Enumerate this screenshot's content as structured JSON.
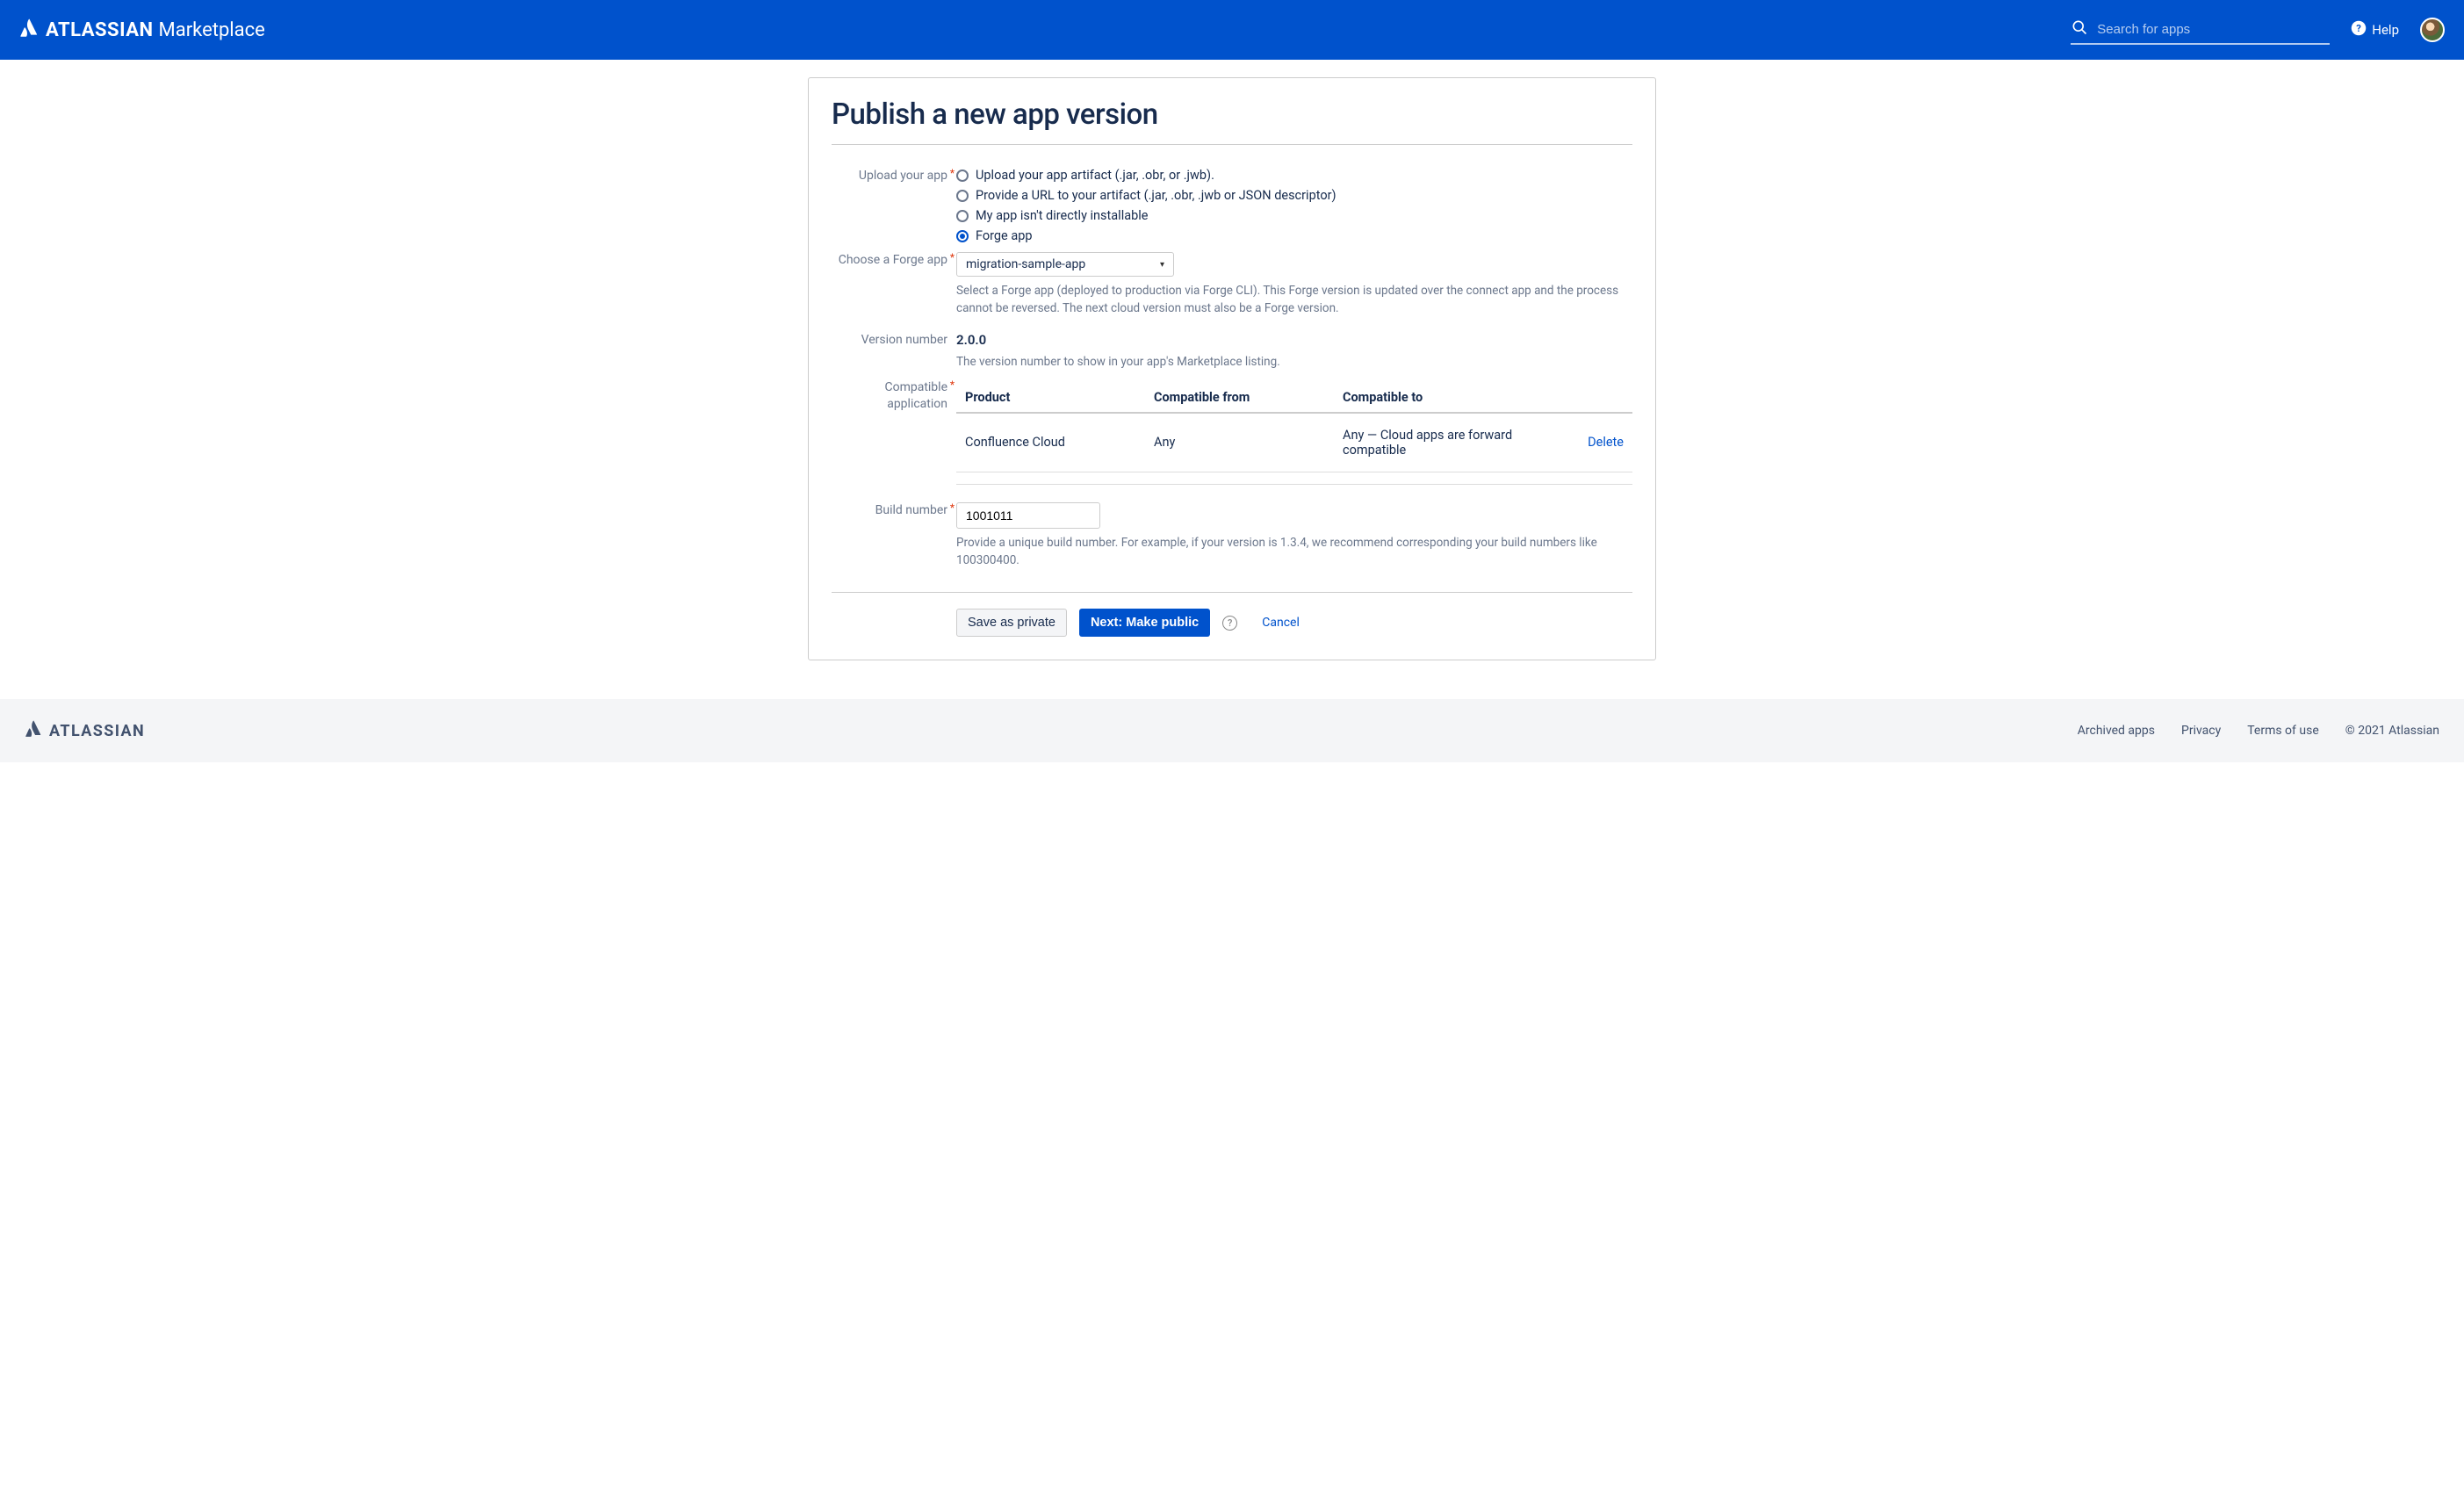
{
  "header": {
    "brand": "ATLASSIAN",
    "brand_sub": "Marketplace",
    "search_placeholder": "Search for apps",
    "help_label": "Help"
  },
  "page": {
    "title": "Publish a new app version"
  },
  "form": {
    "upload_label": "Upload your app",
    "upload_options": {
      "artifact": "Upload your app artifact (.jar, .obr, or .jwb).",
      "url": "Provide a URL to your artifact (.jar, .obr, .jwb or JSON descriptor)",
      "not_installable": "My app isn't directly installable",
      "forge": "Forge app"
    },
    "forge_label": "Choose a Forge app",
    "forge_selected": "migration-sample-app",
    "forge_help": "Select a Forge app (deployed to production via Forge CLI). This Forge version is updated over the connect app and the process cannot be reversed. The next cloud version must also be a Forge version.",
    "version_label": "Version number",
    "version_value": "2.0.0",
    "version_help": "The version number to show in your app's Marketplace listing.",
    "compat_label": "Compatible application",
    "table": {
      "headers": {
        "product": "Product",
        "from": "Compatible from",
        "to": "Compatible to"
      },
      "row": {
        "product": "Confluence Cloud",
        "from": "Any",
        "to": "Any — Cloud apps are forward compatible",
        "delete": "Delete"
      }
    },
    "build_label": "Build number",
    "build_value": "1001011",
    "build_help": "Provide a unique build number. For example, if your version is 1.3.4, we recommend corresponding your build numbers like 100300400."
  },
  "actions": {
    "save_private": "Save as private",
    "next_public": "Next: Make public",
    "cancel": "Cancel"
  },
  "footer": {
    "brand": "ATLASSIAN",
    "links": {
      "archived": "Archived apps",
      "privacy": "Privacy",
      "terms": "Terms of use",
      "copyright": "© 2021 Atlassian"
    }
  }
}
